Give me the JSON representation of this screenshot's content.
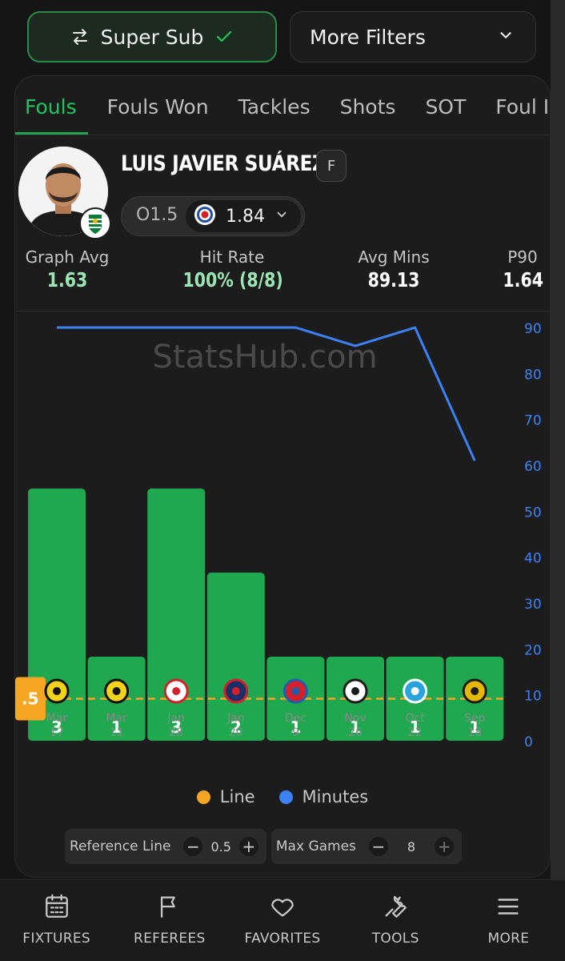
{
  "filters": {
    "super_sub_label": "Super Sub",
    "more_filters_label": "More Filters"
  },
  "tabs": [
    {
      "label": "Fouls",
      "active": true
    },
    {
      "label": "Fouls Won",
      "active": false
    },
    {
      "label": "Tackles",
      "active": false
    },
    {
      "label": "Shots",
      "active": false
    },
    {
      "label": "SOT",
      "active": false
    },
    {
      "label": "Foul Inv",
      "active": false
    }
  ],
  "player": {
    "name": "LUIS JAVIER SUÁREZ",
    "position": "F",
    "line": "O1.5",
    "odds": "1.84"
  },
  "stats": {
    "graph_avg_label": "Graph Avg",
    "graph_avg_value": "1.63",
    "hit_rate_label": "Hit Rate",
    "hit_rate_value": "100% (8/8)",
    "avg_mins_label": "Avg Mins",
    "avg_mins_value": "89.13",
    "p90_label": "P90",
    "p90_value": "1.64"
  },
  "chart_data": {
    "type": "bar",
    "watermark": "StatsHub.com",
    "categories": [
      "Mar 17",
      "Mar 11",
      "Jan 28",
      "Jan 20",
      "Dec 9",
      "Nov 26",
      "Oct 22",
      "Sep 18"
    ],
    "category_lines": [
      [
        "Mar",
        "17"
      ],
      [
        "Mar",
        "11"
      ],
      [
        "Jan",
        "28"
      ],
      [
        "Jan",
        "20"
      ],
      [
        "Dec",
        "9"
      ],
      [
        "Nov",
        "26"
      ],
      [
        "Oct",
        "22"
      ],
      [
        "Sep",
        "18"
      ]
    ],
    "series": [
      {
        "name": "Fouls",
        "values": [
          3,
          1,
          3,
          2,
          1,
          1,
          1,
          1
        ],
        "color": "#1fa84f"
      },
      {
        "name": "Minutes",
        "values": [
          90,
          90,
          90,
          90,
          90,
          86,
          90,
          61
        ],
        "color": "#3b82f6",
        "axis": "right"
      }
    ],
    "reference_line": {
      "value": 0.5,
      "label": ".5",
      "color": "#f5a623"
    },
    "y_right_ticks": [
      90,
      80,
      70,
      60,
      50,
      40,
      30,
      20,
      10,
      0
    ],
    "y_right_range": [
      0,
      90
    ],
    "y_left_range": [
      0,
      3
    ],
    "opponents": [
      "bodo-glimt-icon",
      "bodo-glimt-icon",
      "athletic-club-icon",
      "psg-icon",
      "bayern-icon",
      "club-brugge-icon",
      "marseille-icon",
      "kairat-icon"
    ],
    "legend": [
      "Line",
      "Minutes"
    ]
  },
  "legend": {
    "line_label": "Line",
    "line_color": "#f5a623",
    "minutes_label": "Minutes",
    "minutes_color": "#3b82f6"
  },
  "controls": {
    "reference_line_label": "Reference Line",
    "reference_line_value": "0.5",
    "max_games_label": "Max Games",
    "max_games_value": "8"
  },
  "nav": [
    {
      "label": "FIXTURES",
      "icon": "calendar-icon"
    },
    {
      "label": "REFEREES",
      "icon": "flag-icon"
    },
    {
      "label": "FAVORITES",
      "icon": "heart-icon"
    },
    {
      "label": "TOOLS",
      "icon": "wrench-icon"
    },
    {
      "label": "MORE",
      "icon": "menu-icon"
    }
  ]
}
